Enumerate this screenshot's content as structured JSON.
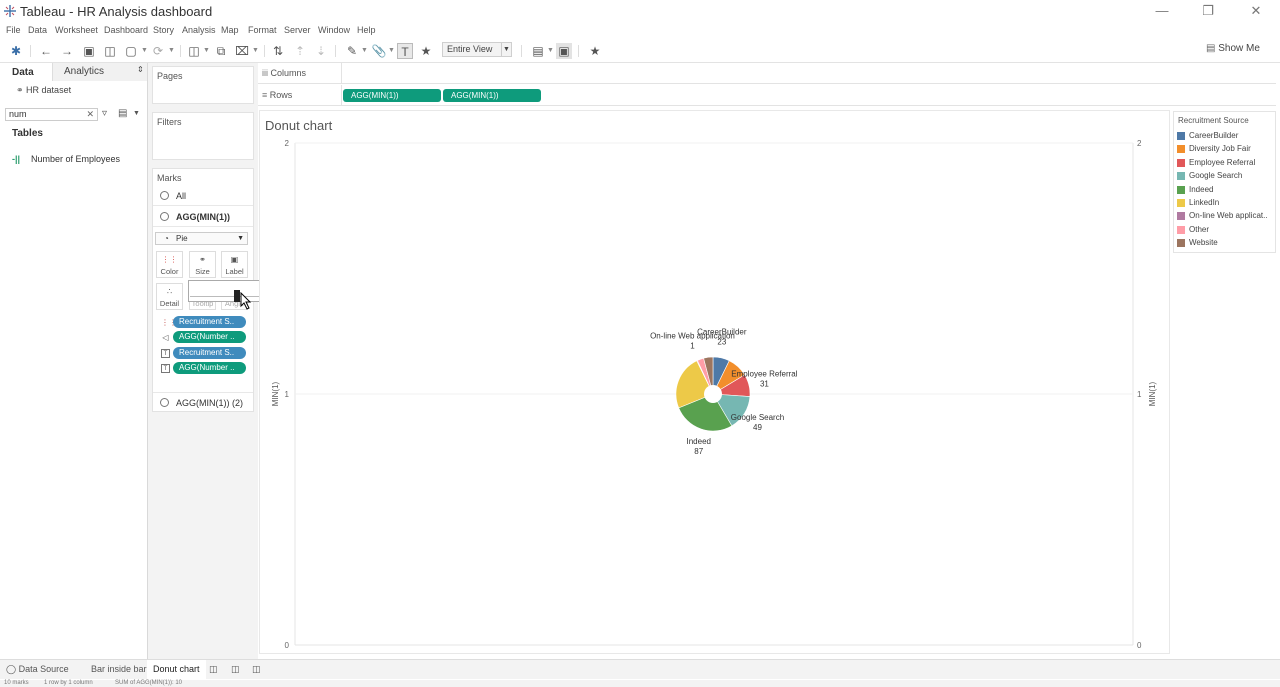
{
  "window": {
    "title": "Tableau - HR Analysis dashboard",
    "icon": "tableau-logo-icon"
  },
  "menu": [
    "File",
    "Data",
    "Worksheet",
    "Dashboard",
    "Story",
    "Analysis",
    "Map",
    "Format",
    "Server",
    "Window",
    "Help"
  ],
  "toolbar": {
    "fit_select": "Entire View",
    "show_me": "Show Me"
  },
  "data_pane": {
    "tab_data": "Data",
    "tab_analytics": "Analytics",
    "datasource": "HR dataset",
    "search_value": "num",
    "tables_header": "Tables",
    "fields": [
      {
        "name": "Number of Employees",
        "icon": "measure-icon"
      }
    ]
  },
  "cards": {
    "pages": "Pages",
    "filters": "Filters",
    "marks": "Marks",
    "marks_all": "All",
    "marks_layer1": "AGG(MIN(1))",
    "mark_type": "Pie",
    "props": {
      "color": "Color",
      "size": "Size",
      "label": "Label",
      "detail": "Detail",
      "tooltip": "Tooltip",
      "angle": "Angle"
    },
    "mark_pills": [
      {
        "label": "Recruitment S..",
        "icon": "color-icon",
        "kind": "dimension"
      },
      {
        "label": "AGG(Number ..",
        "icon": "angle-icon",
        "kind": "measure"
      },
      {
        "label": "Recruitment S..",
        "icon": "label-icon",
        "kind": "dimension"
      },
      {
        "label": "AGG(Number ..",
        "icon": "label-icon",
        "kind": "measure"
      }
    ],
    "marks_layer2": "AGG(MIN(1)) (2)"
  },
  "shelves": {
    "columns_label": "Columns",
    "rows_label": "Rows",
    "rows_pills": [
      "AGG(MIN(1))",
      "AGG(MIN(1))"
    ]
  },
  "sheet": {
    "title": "Donut chart"
  },
  "chart_data": {
    "type": "pie",
    "subtype": "donut",
    "ylabel_left": "MIN(1)",
    "ylabel_right": "MIN(1)",
    "y_ticks": [
      "2",
      "1",
      "0"
    ],
    "ylim": [
      0,
      2
    ],
    "legend_title": "Recruitment Source",
    "legend_position": "right",
    "slices": [
      {
        "name": "CareerBuilder",
        "value": 23,
        "color": "#4e79a7",
        "label_shown": true
      },
      {
        "name": "Diversity Job Fair",
        "value": 29,
        "color": "#f28e2b",
        "label_shown": false
      },
      {
        "name": "Employee Referral",
        "value": 31,
        "color": "#e15759",
        "label_shown": true
      },
      {
        "name": "Google Search",
        "value": 49,
        "color": "#76b7b2",
        "label_shown": true
      },
      {
        "name": "Indeed",
        "value": 87,
        "color": "#59a14f",
        "label_shown": true
      },
      {
        "name": "LinkedIn",
        "value": 76,
        "color": "#edc948",
        "label_shown": false
      },
      {
        "name": "On-line Web application",
        "value": 1,
        "color": "#b07aa1",
        "label_shown": true
      },
      {
        "name": "Other",
        "value": 9,
        "color": "#ff9da7",
        "label_shown": false
      },
      {
        "name": "Website",
        "value": 13,
        "color": "#9c755f",
        "label_shown": false
      }
    ],
    "legend_labels": [
      "CareerBuilder",
      "Diversity Job Fair",
      "Employee Referral",
      "Google Search",
      "Indeed",
      "LinkedIn",
      "On-line Web applicat..",
      "Other",
      "Website"
    ]
  },
  "sheet_tabs": [
    "Data Source",
    "Bar inside bar",
    "Donut chart"
  ],
  "status": {
    "marks": "10 marks",
    "rows_cols": "1 row by 1 column",
    "sum": "SUM of AGG(MIN(1)): 10"
  }
}
